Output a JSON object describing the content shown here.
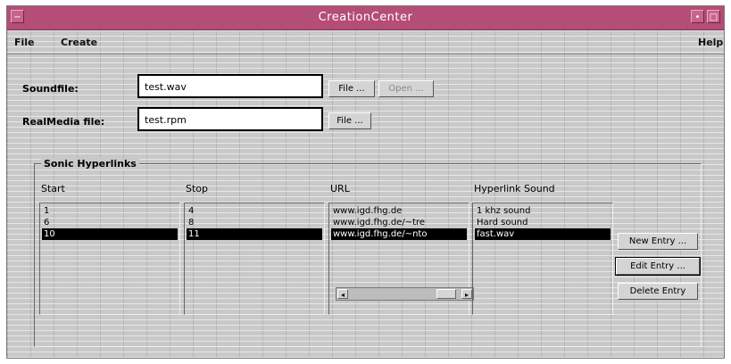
{
  "window": {
    "title": "CreationCenter"
  },
  "menubar": {
    "file": "File",
    "create": "Create",
    "help": "Help"
  },
  "soundfile": {
    "label": "Soundfile:",
    "value": "test.wav",
    "file_button": "File ...",
    "open_button": "Open ..."
  },
  "realmedia": {
    "label": "RealMedia file:",
    "value": "test.rpm",
    "file_button": "File ..."
  },
  "hyperlinks": {
    "title": "Sonic Hyperlinks",
    "headers": {
      "start": "Start",
      "stop": "Stop",
      "url": "URL",
      "sound": "Hyperlink Sound"
    },
    "rows": [
      {
        "start": "1",
        "stop": "4",
        "url": "www.igd.fhg.de",
        "sound": "1 khz sound"
      },
      {
        "start": "6",
        "stop": "8",
        "url": "www.igd.fhg.de/~tre",
        "sound": "Hard sound"
      },
      {
        "start": "10",
        "stop": "11",
        "url": "www.igd.fhg.de/~nto",
        "sound": "fast.wav"
      }
    ],
    "selected_row": 2
  },
  "actions": {
    "new_entry": "New Entry ...",
    "edit_entry": "Edit Entry ...",
    "delete_entry": "Delete Entry"
  }
}
